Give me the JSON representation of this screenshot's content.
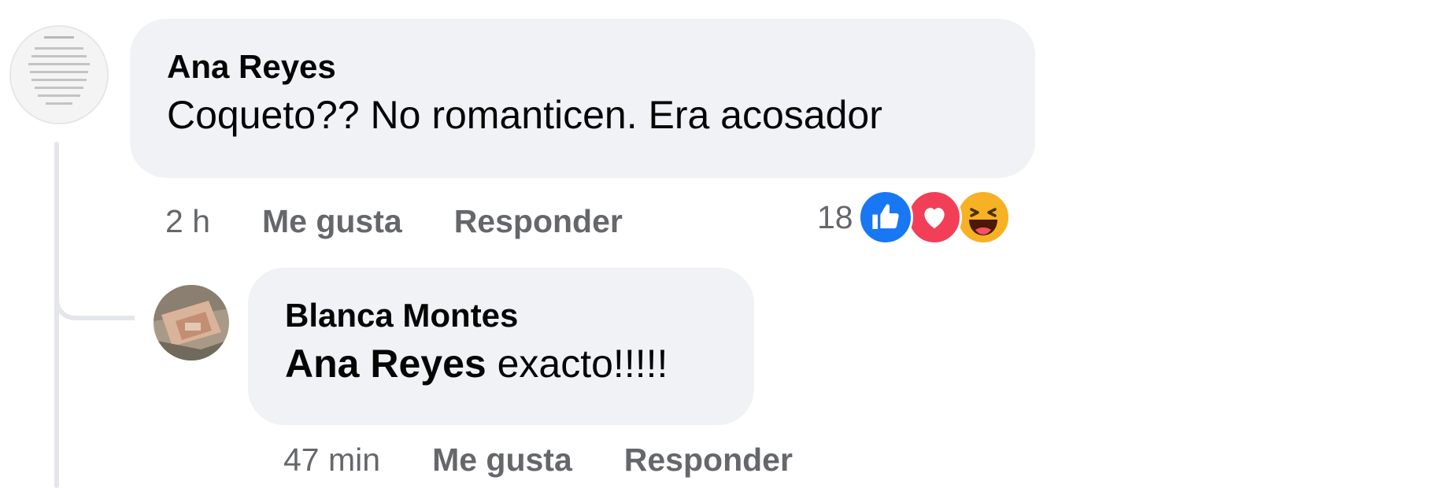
{
  "comments": [
    {
      "author": "Ana Reyes",
      "text": "Coqueto?? No romanticen. Era acosador",
      "time": "2 h",
      "like_label": "Me gusta",
      "reply_label": "Responder",
      "reaction_count": "18",
      "reactions": [
        "like-icon",
        "love-icon",
        "haha-icon"
      ]
    },
    {
      "author": "Blanca Montes",
      "mention": "Ana Reyes",
      "text": "exacto!!!!!",
      "time": "47 min",
      "like_label": "Me gusta",
      "reply_label": "Responder"
    }
  ],
  "colors": {
    "bubble": "#f0f2f5",
    "meta_text": "#65676b",
    "like_blue": "#1877f2",
    "love_red": "#f33e58",
    "haha_yellow": "#f7b125",
    "thread_line": "#e4e6eb"
  }
}
